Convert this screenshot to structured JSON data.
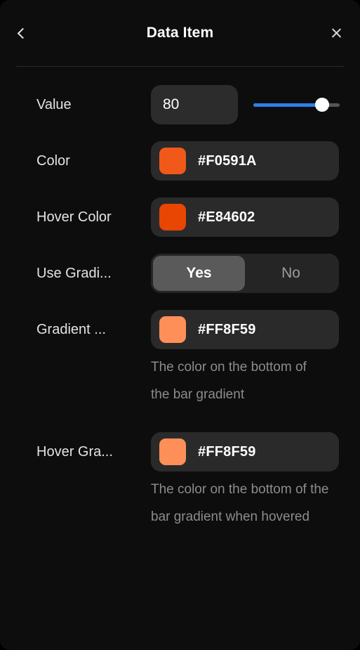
{
  "header": {
    "title": "Data Item",
    "back_icon": "chevron-left-icon",
    "close_icon": "close-icon"
  },
  "fields": {
    "value": {
      "label": "Value",
      "value": "80",
      "placeholder": "",
      "slider": {
        "min": 0,
        "max": 100,
        "current": 80,
        "fill_percent": 80,
        "fill_color": "#2F7FE8",
        "track_color": "#555555",
        "thumb_color": "#FFFFFF"
      }
    },
    "color": {
      "label": "Color",
      "hex": "#F0591A",
      "swatch_color": "#F0591A"
    },
    "hover_color": {
      "label": "Hover Color",
      "hex": "#E84602",
      "swatch_color": "#E84602"
    },
    "use_gradient": {
      "label": "Use Gradi...",
      "options": [
        {
          "label": "Yes",
          "selected": true
        },
        {
          "label": "No",
          "selected": false
        }
      ]
    },
    "gradient_color": {
      "label": "Gradient ...",
      "hex": "#FF8F59",
      "swatch_color": "#FF8F59",
      "description": "The color on the bottom of the bar gradient"
    },
    "hover_gradient_color": {
      "label": "Hover Gra...",
      "hex": "#FF8F59",
      "swatch_color": "#FF8F59",
      "description": "The color on the bottom of the bar gradient when hovered"
    }
  }
}
